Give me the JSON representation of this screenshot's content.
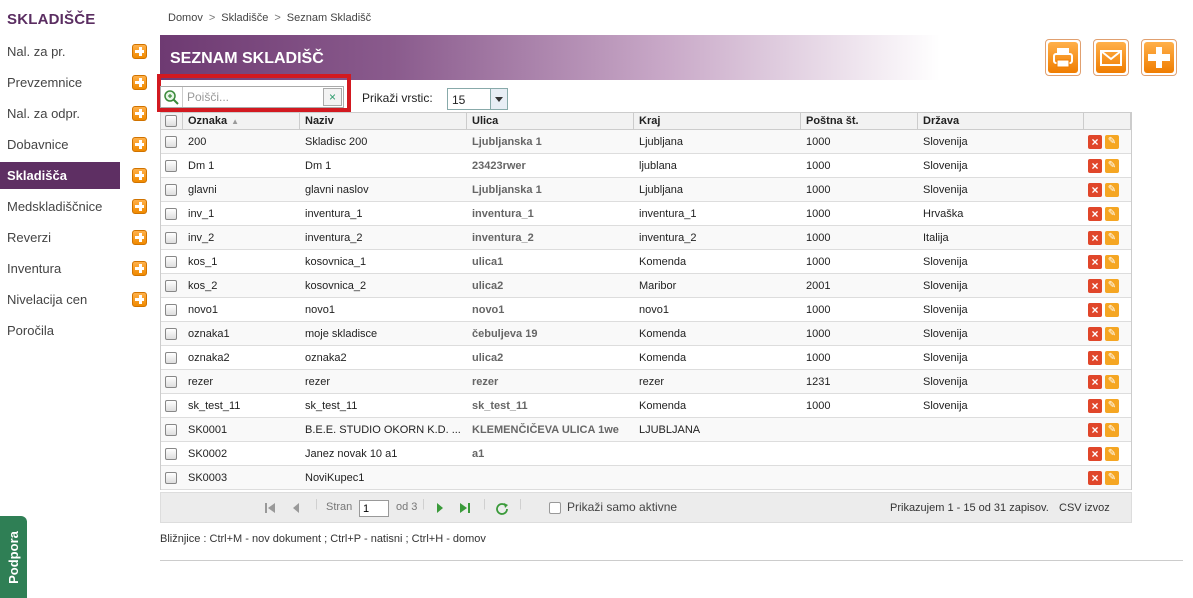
{
  "sidebar": {
    "title": "SKLADIŠČE",
    "items": [
      {
        "label": "Nal. za pr.",
        "plus": true
      },
      {
        "label": "Prevzemnice",
        "plus": true
      },
      {
        "label": "Nal. za odpr.",
        "plus": true
      },
      {
        "label": "Dobavnice",
        "plus": true
      },
      {
        "label": "Skladišča",
        "plus": true,
        "active": true
      },
      {
        "label": "Medskladiščnice",
        "plus": true
      },
      {
        "label": "Reverzi",
        "plus": true
      },
      {
        "label": "Inventura",
        "plus": true
      },
      {
        "label": "Nivelacija cen",
        "plus": true
      },
      {
        "label": "Poročila",
        "plus": false
      }
    ],
    "support_label": "Podpora"
  },
  "breadcrumb": {
    "items": [
      "Domov",
      "Skladišče",
      "Seznam Skladišč"
    ],
    "separator": ">"
  },
  "header": {
    "title": "SEZNAM SKLADIŠČ"
  },
  "toolbar": {
    "print_icon": "printer-icon",
    "email_icon": "envelope-icon",
    "add_icon": "plus-icon"
  },
  "search": {
    "placeholder": "Poišči...",
    "value": "",
    "clear_label": "×"
  },
  "rows_per_page": {
    "label": "Prikaži vrstic:",
    "selected": "15"
  },
  "table": {
    "columns": [
      "Oznaka",
      "Naziv",
      "Ulica",
      "Kraj",
      "Poštna št.",
      "Država"
    ],
    "rows": [
      [
        "200",
        "Skladisc 200",
        "Ljubljanska 1",
        "Ljubljana",
        "1000",
        "Slovenija"
      ],
      [
        "Dm 1",
        "Dm 1",
        "23423rwer",
        "ljublana",
        "1000",
        "Slovenija"
      ],
      [
        "glavni",
        "glavni naslov",
        "Ljubljanska 1",
        "Ljubljana",
        "1000",
        "Slovenija"
      ],
      [
        "inv_1",
        "inventura_1",
        "inventura_1",
        "inventura_1",
        "1000",
        "Hrvaška"
      ],
      [
        "inv_2",
        "inventura_2",
        "inventura_2",
        "inventura_2",
        "1000",
        "Italija"
      ],
      [
        "kos_1",
        "kosovnica_1",
        "ulica1",
        "Komenda",
        "1000",
        "Slovenija"
      ],
      [
        "kos_2",
        "kosovnica_2",
        "ulica2",
        "Maribor",
        "2001",
        "Slovenija"
      ],
      [
        "novo1",
        "novo1",
        "novo1",
        "novo1",
        "1000",
        "Slovenija"
      ],
      [
        "oznaka1",
        "moje skladisce",
        "čebuljeva 19",
        "Komenda",
        "1000",
        "Slovenija"
      ],
      [
        "oznaka2",
        "oznaka2",
        "ulica2",
        "Komenda",
        "1000",
        "Slovenija"
      ],
      [
        "rezer",
        "rezer",
        "rezer",
        "rezer",
        "1231",
        "Slovenija"
      ],
      [
        "sk_test_11",
        "sk_test_11",
        "sk_test_11",
        "Komenda",
        "1000",
        "Slovenija"
      ],
      [
        "SK0001",
        "B.E.E. STUDIO OKORN K.D. ...",
        "KLEMENČIČEVA ULICA 1we",
        "LJUBLJANA",
        "",
        ""
      ],
      [
        "SK0002",
        "Janez novak 10 a1",
        "a1",
        "",
        "",
        ""
      ],
      [
        "SK0003",
        "NoviKupec1",
        "",
        "",
        "",
        ""
      ]
    ]
  },
  "pager": {
    "page_label": "Stran",
    "page_value": "1",
    "of_label": "od 3",
    "active_only_label": "Prikaži samo aktivne",
    "summary": "Prikazujem 1 - 15 od 31 zapisov.",
    "csv_label": "CSV izvoz"
  },
  "shortcuts": "Bližnjice : Ctrl+M - nov dokument ;   Ctrl+P - natisni ;   Ctrl+H - domov"
}
